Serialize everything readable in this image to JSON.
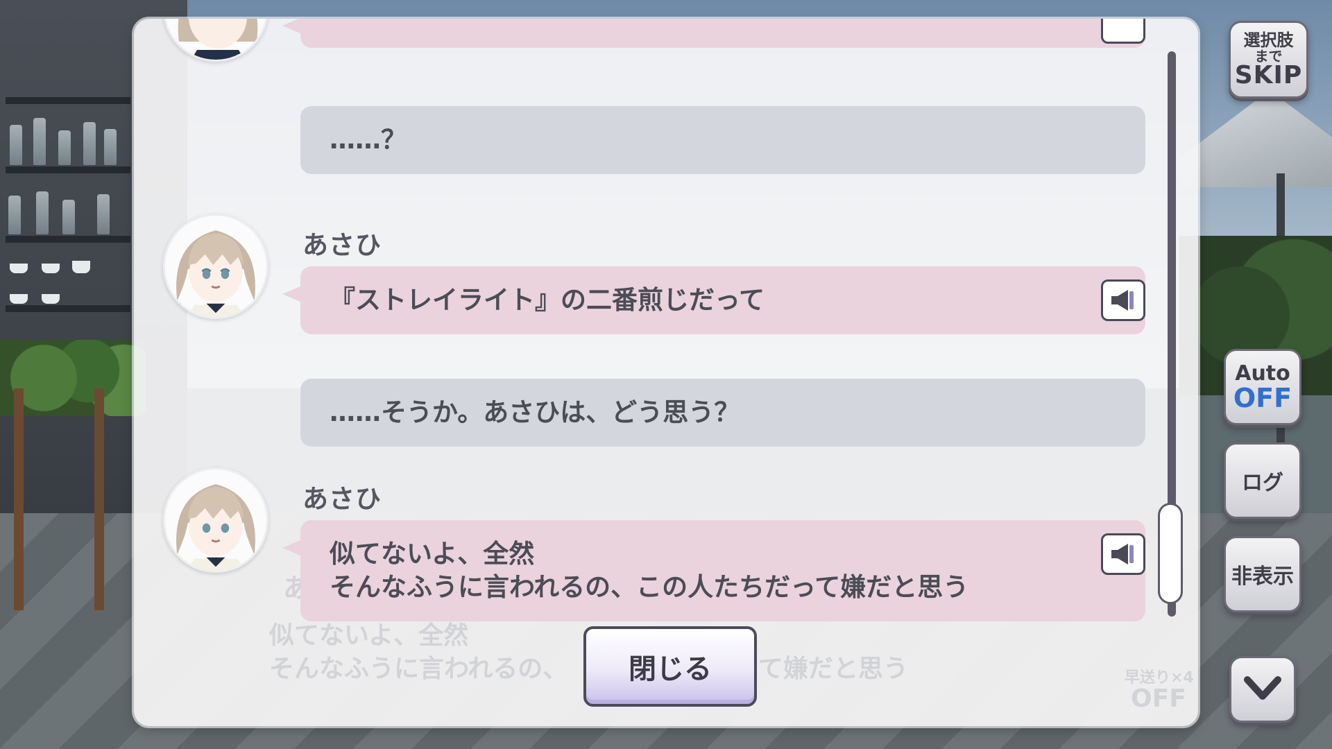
{
  "skip_button": {
    "line1": "選択肢",
    "line2": "まで",
    "line3": "SKIP"
  },
  "auto_button": {
    "label": "Auto",
    "state": "OFF"
  },
  "log_button": {
    "label": "ログ"
  },
  "hide_button": {
    "label": "非表示"
  },
  "down_button": {
    "icon": "chevron-down-icon"
  },
  "background_textbox": {
    "name": "あさひ",
    "line1": "似てないよ、全然",
    "line2": "そんなふうに言われるの、",
    "line2_tail": "て嫌だと思う",
    "fast_forward": "早送り×4",
    "fast_forward_state": "OFF"
  },
  "log": {
    "entries": [
      {
        "type": "gray",
        "text": "……？"
      },
      {
        "type": "pink",
        "speaker": "あさひ",
        "lines": [
          "『ストレイライト』の二番煎じだって"
        ],
        "voice_icon": "speaker-icon"
      },
      {
        "type": "gray",
        "text": "……そうか。あさひは、どう思う？"
      },
      {
        "type": "pink",
        "speaker": "あさひ",
        "lines": [
          "似てないよ、全然",
          "そんなふうに言われるの、この人たちだって嫌だと思う"
        ],
        "voice_icon": "speaker-icon"
      }
    ],
    "close_label": "閉じる"
  },
  "colors": {
    "pink_bubble": "#ead3dd",
    "gray_bubble": "#d3d7dd",
    "auto_off": "#2f6fd0",
    "text": "#4c4c56"
  }
}
